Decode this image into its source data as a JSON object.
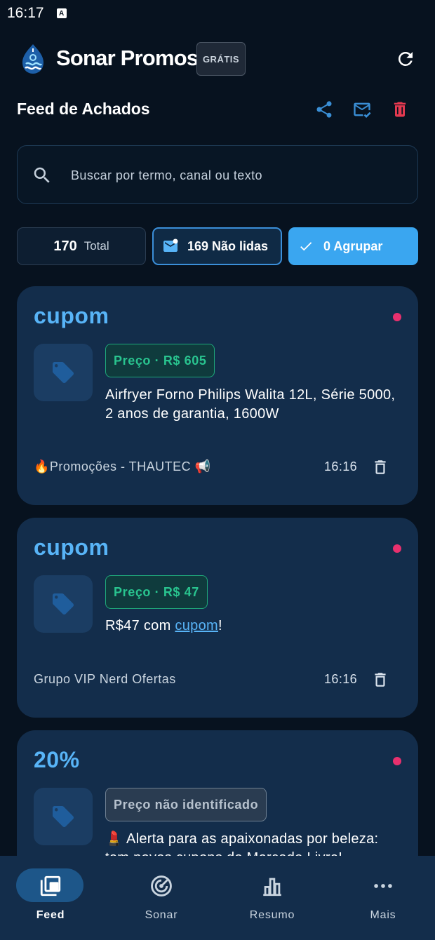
{
  "status_bar": {
    "time": "16:17",
    "indicator": "A"
  },
  "app": {
    "title": "Sonar Promos",
    "plan_badge": "GRÁTIS"
  },
  "section": {
    "title": "Feed de Achados"
  },
  "search": {
    "placeholder": "Buscar por termo, canal ou texto",
    "value": ""
  },
  "filters": {
    "total_count": "170",
    "total_label": "Total",
    "unread_label": "169 Não lidas",
    "group_label": "0 Agrupar"
  },
  "feed": [
    {
      "keyword": "cupom",
      "price": "Preço · R$ 605",
      "price_status": "identified",
      "description": "Airfryer Forno Philips Walita 12L, Série 5000, 2 anos de garantia, 1600W",
      "source": "🔥Promoções - THAUTEC 📢",
      "time": "16:16",
      "unread": true
    },
    {
      "keyword": "cupom",
      "price": "Preço · R$ 47",
      "price_status": "identified",
      "description_pre": "R$47 com ",
      "description_link": "cupom",
      "description_post": "!",
      "source": "Grupo VIP Nerd Ofertas",
      "time": "16:16",
      "unread": true
    },
    {
      "keyword": "20%",
      "price": "Preço não identificado",
      "price_status": "not_identified",
      "description": "💄 Alerta para as apaixonadas por beleza: tem novos cupons do Mercado Livre!",
      "unread": true
    }
  ],
  "bottom_nav": [
    {
      "label": "Feed",
      "icon": "feed-icon",
      "active": true
    },
    {
      "label": "Sonar",
      "icon": "radar-icon",
      "active": false
    },
    {
      "label": "Resumo",
      "icon": "bar-chart-icon",
      "active": false
    },
    {
      "label": "Mais",
      "icon": "more-dots-icon",
      "active": false
    }
  ],
  "colors": {
    "background": "#07121f",
    "card": "#132d4b",
    "accent": "#58b4f7",
    "primary_button": "#3aa6f0",
    "price_green": "#29c48f",
    "unread_dot": "#e8306e",
    "delete_red": "#e53950"
  }
}
